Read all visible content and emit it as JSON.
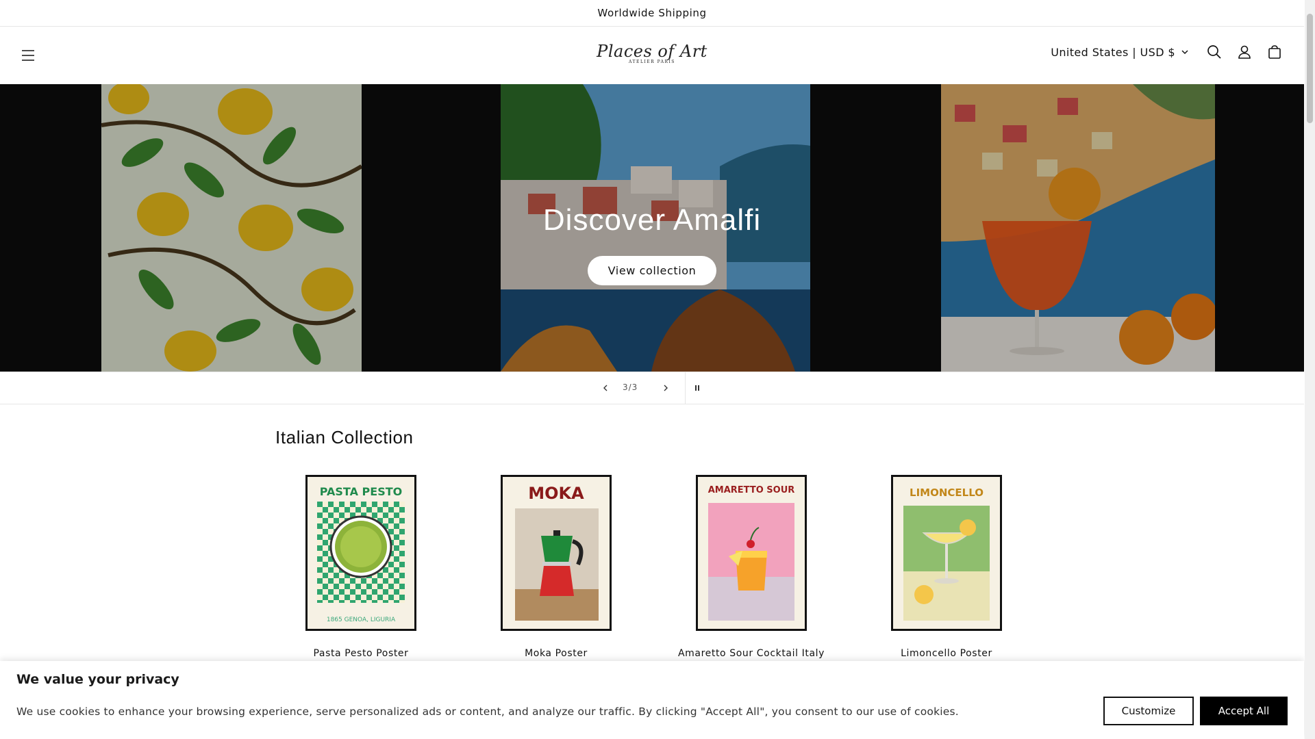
{
  "announcement": {
    "text": "Worldwide Shipping"
  },
  "header": {
    "logo_main": "Places of Art",
    "logo_sub": "ATELIER PARIS",
    "locale": "United States | USD $"
  },
  "hero": {
    "title": "Discover Amalfi",
    "cta": "View collection",
    "pager": "3/3"
  },
  "collection": {
    "title": "Italian Collection",
    "products": [
      {
        "title": "Pasta Pesto Poster",
        "poster_heading": "PASTA PESTO",
        "poster_caption": "1865 GENOA, LIGURIA",
        "heading_color": "#1f8a4c"
      },
      {
        "title": "Moka Poster",
        "poster_heading": "MOKA",
        "heading_color": "#8a1a1a"
      },
      {
        "title": "Amaretto Sour Cocktail Italy",
        "poster_heading": "AMARETTO SOUR",
        "heading_color": "#9a1f1f"
      },
      {
        "title": "Limoncello Poster",
        "poster_heading": "LIMONCELLO",
        "heading_color": "#c2871a"
      }
    ]
  },
  "cookie": {
    "title": "We value your privacy",
    "text": "We use cookies to enhance your browsing experience, serve personalized ads or content, and analyze our traffic. By clicking \"Accept All\", you consent to our use of cookies.",
    "customize_label": "Customize",
    "accept_label": "Accept All"
  },
  "icons": [
    "hamburger-menu-icon",
    "search-icon",
    "account-icon",
    "cart-icon",
    "chevron-down-icon",
    "chevron-left-icon",
    "chevron-right-icon",
    "pause-icon"
  ]
}
